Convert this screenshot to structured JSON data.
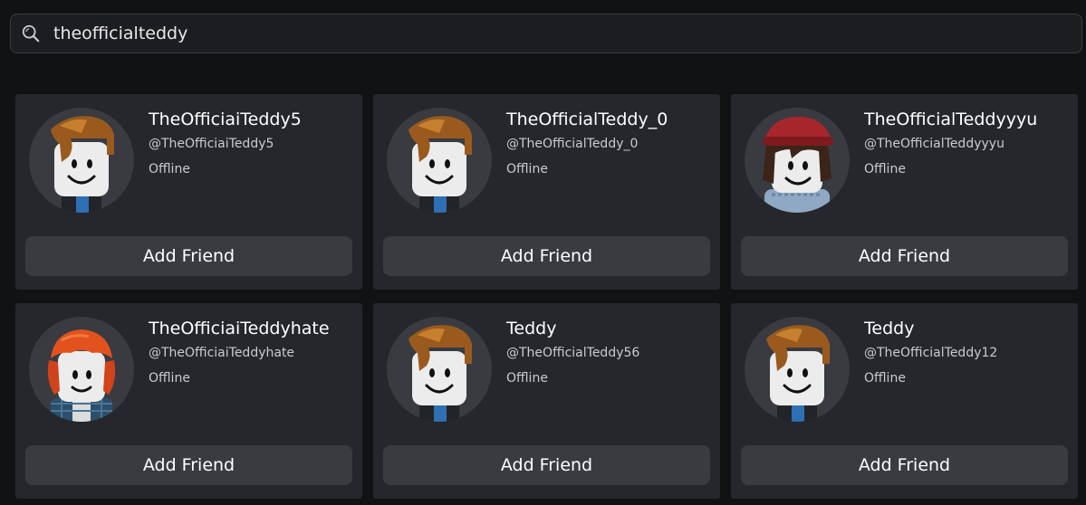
{
  "search": {
    "value": "theofficialteddy",
    "icon": "search-icon"
  },
  "colors": {
    "background": "#111214",
    "card": "#25272c",
    "button": "#393b41",
    "secondary_text": "#c9cbd0"
  },
  "results": [
    {
      "display_name": "TheOfficiaiTeddy5",
      "username": "@TheOfficiaiTeddy5",
      "status": "Offline",
      "button_label": "Add Friend",
      "avatar": "classic-brown-hair"
    },
    {
      "display_name": "TheOfficialTeddy_0",
      "username": "@TheOfficialTeddy_0",
      "status": "Offline",
      "button_label": "Add Friend",
      "avatar": "classic-brown-hair"
    },
    {
      "display_name": "TheOfficialTeddyyyu",
      "username": "@TheOfficialTeddyyyu",
      "status": "Offline",
      "button_label": "Add Friend",
      "avatar": "red-beanie-dark-hair"
    },
    {
      "display_name": "TheOfficiaiTeddyhate",
      "username": "@TheOfficiaiTeddyhate",
      "status": "Offline",
      "button_label": "Add Friend",
      "avatar": "orange-hair-plaid"
    },
    {
      "display_name": "Teddy",
      "username": "@TheOfficialTeddy56",
      "status": "Offline",
      "button_label": "Add Friend",
      "avatar": "classic-brown-hair"
    },
    {
      "display_name": "Teddy",
      "username": "@TheOfficialTeddy12",
      "status": "Offline",
      "button_label": "Add Friend",
      "avatar": "classic-brown-hair"
    }
  ]
}
